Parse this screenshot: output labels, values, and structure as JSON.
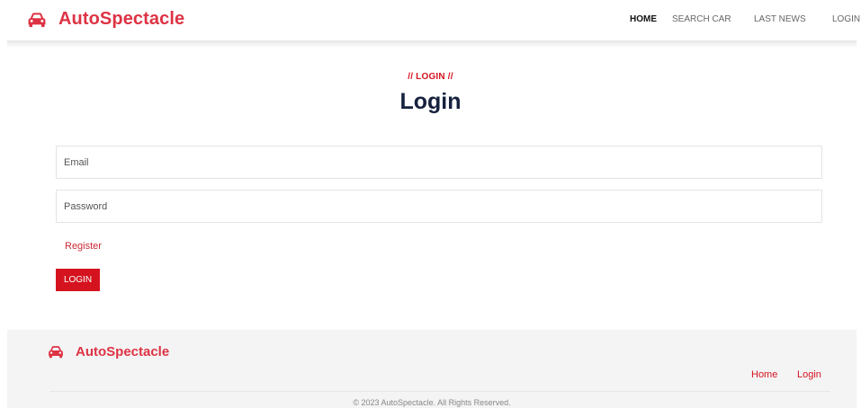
{
  "header": {
    "brand": "AutoSpectacle",
    "nav": [
      {
        "label": "HOME",
        "active": true
      },
      {
        "label": "SEARCH CAR",
        "active": false
      },
      {
        "label": "LAST NEWS",
        "active": false
      },
      {
        "label": "LOGIN",
        "active": false
      }
    ]
  },
  "main": {
    "eyebrow": "// LOGIN //",
    "title": "Login",
    "email_placeholder": "Email",
    "password_placeholder": "Password",
    "register_link": "Register",
    "login_button": "LOGIN"
  },
  "footer": {
    "brand": "AutoSpectacle",
    "links": [
      "Home",
      "Login"
    ],
    "copyright": "© 2023 AutoSpectacle. All Rights Reserved."
  },
  "colors": {
    "brand": "#dd3344",
    "accent": "#d4131f",
    "heading": "#16213e"
  },
  "icons": {
    "brand_icon": "car-icon"
  }
}
